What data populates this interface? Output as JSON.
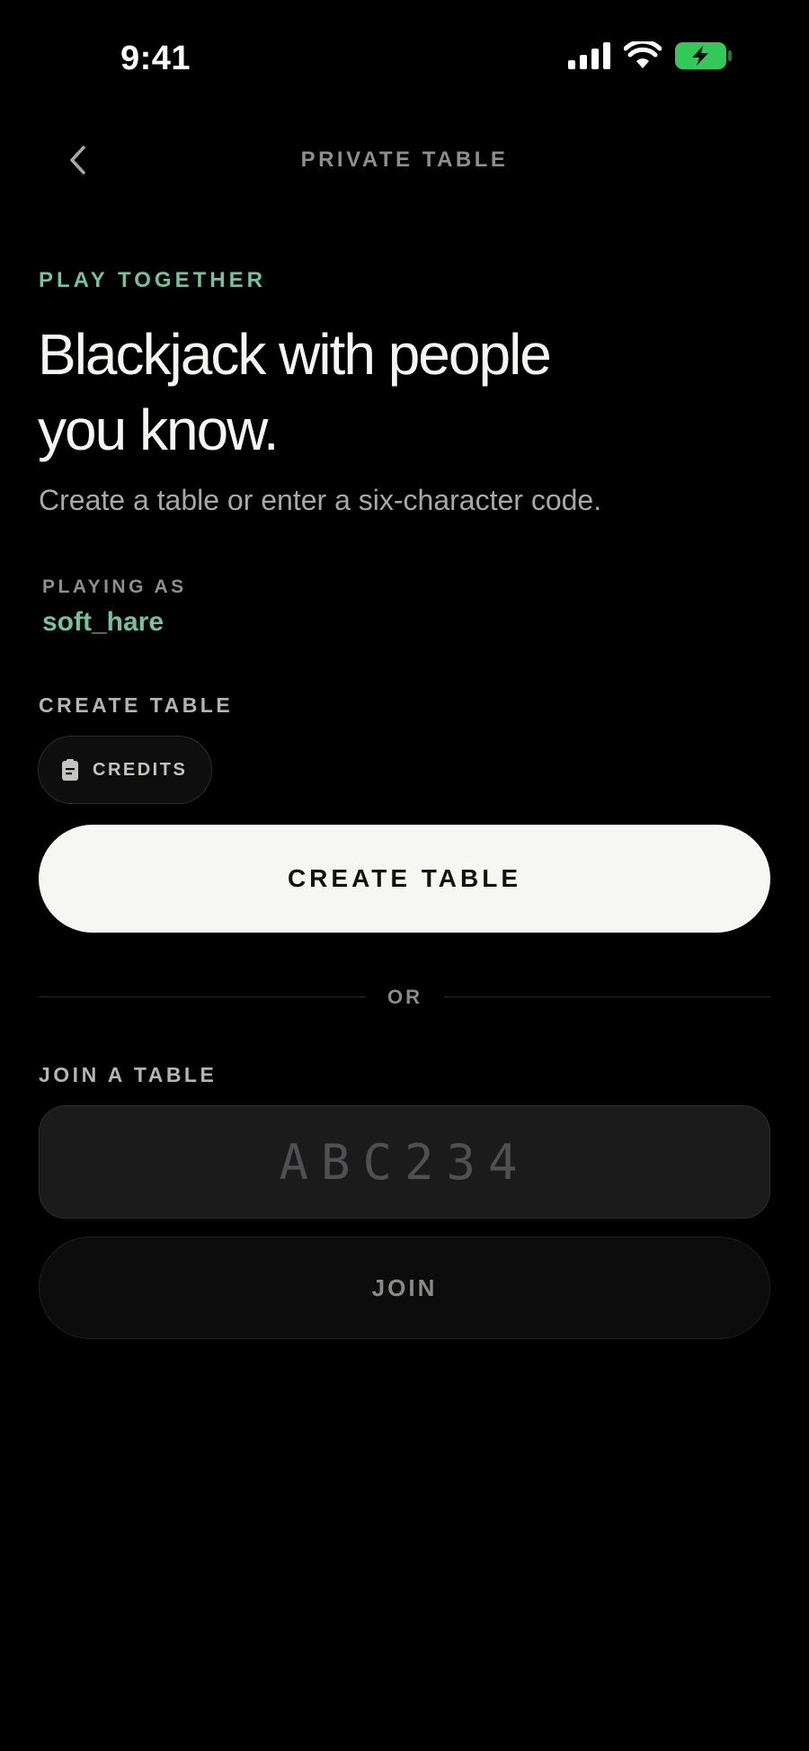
{
  "status_bar": {
    "time": "9:41",
    "icons": [
      "signal-icon",
      "wifi-icon",
      "battery-charging-icon"
    ],
    "battery_color": "#34c759"
  },
  "nav": {
    "title": "PRIVATE TABLE",
    "back_icon": "chevron-left-icon"
  },
  "hero": {
    "eyebrow": "PLAY TOGETHER",
    "headline_line1": "Blackjack with people",
    "headline_line2": "you know.",
    "subhead": "Create a table or enter a six-character code."
  },
  "player": {
    "label": "PLAYING AS",
    "username": "soft_hare"
  },
  "create": {
    "section_label": "CREATE TABLE",
    "chip_label": "CREDITS",
    "chip_icon": "clipboard-icon",
    "button_label": "CREATE TABLE"
  },
  "divider": {
    "text": "OR"
  },
  "join": {
    "section_label": "JOIN A TABLE",
    "code_value": "",
    "code_placeholder": "ABC234",
    "button_label": "JOIN"
  },
  "colors": {
    "background": "#000000",
    "accent": "#74c29e",
    "primary_button": "#f6f6f3",
    "muted_text": "#8e8e8c"
  }
}
